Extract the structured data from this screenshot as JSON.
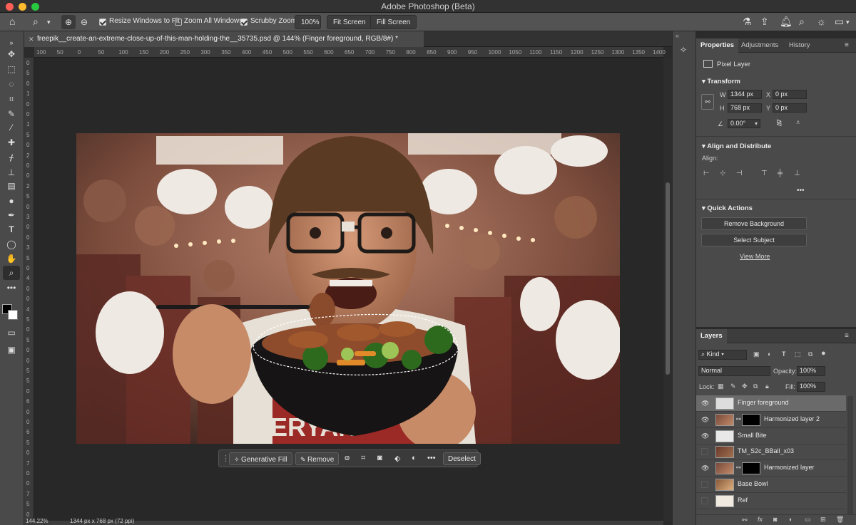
{
  "window": {
    "title": "Adobe Photoshop (Beta)"
  },
  "options_bar": {
    "resize_windows_label": "Resize Windows to Fit",
    "zoom_all_label": "Zoom All Windows",
    "scrubby_zoom_label": "Scrubby Zoom",
    "zoom_value": "100%",
    "fit_screen": "Fit Screen",
    "fill_screen": "Fill Screen"
  },
  "document": {
    "tab_title": "freepik__create-an-extreme-close-up-of-this-man-holding-the__35735.psd @ 144% (Finger foreground, RGB/8#) *"
  },
  "ruler": {
    "h_ticks": [
      "100",
      "50",
      "0",
      "50",
      "100",
      "150",
      "200",
      "250",
      "300",
      "350",
      "400",
      "450",
      "500",
      "550",
      "600",
      "650",
      "700",
      "750",
      "800",
      "850",
      "900",
      "950",
      "1000",
      "1050",
      "1100",
      "1150",
      "1200",
      "1250",
      "1300",
      "1350",
      "1400"
    ],
    "v_ticks": [
      "0",
      "5",
      "0",
      "1",
      "0",
      "0",
      "1",
      "5",
      "0",
      "2",
      "0",
      "0",
      "2",
      "5",
      "0",
      "3",
      "0",
      "0",
      "3",
      "5",
      "0",
      "4",
      "0",
      "0",
      "4",
      "5",
      "0",
      "5",
      "0",
      "0",
      "5",
      "5",
      "0",
      "6",
      "0",
      "0",
      "6",
      "5",
      "0",
      "7",
      "0",
      "0",
      "7",
      "5",
      "0"
    ]
  },
  "context_bar": {
    "generative_fill": "Generative Fill",
    "remove": "Remove",
    "deselect": "Deselect"
  },
  "status": {
    "zoom": "144.22%",
    "doc_size": "1344 px x 768 px (72 ppi)"
  },
  "properties": {
    "tabs": [
      "Properties",
      "Adjustments",
      "History"
    ],
    "layer_type": "Pixel Layer",
    "transform_title": "Transform",
    "w_label": "W",
    "w_value": "1344 px",
    "h_label": "H",
    "h_value": "768 px",
    "x_label": "X",
    "x_value": "0 px",
    "y_label": "Y",
    "y_value": "0 px",
    "angle_value": "0.00°",
    "align_title": "Align and Distribute",
    "align_label": "Align:",
    "quick_actions_title": "Quick Actions",
    "remove_background": "Remove Background",
    "select_subject": "Select Subject",
    "view_more": "View More"
  },
  "layers_panel": {
    "title": "Layers",
    "kind": "Kind",
    "blend_mode": "Normal",
    "opacity_label": "Opacity:",
    "opacity_value": "100%",
    "lock_label": "Lock:",
    "fill_label": "Fill:",
    "fill_value": "100%",
    "layers": [
      {
        "name": "Finger foreground",
        "visible": true,
        "selected": true
      },
      {
        "name": "Harmonized layer 2",
        "visible": true,
        "selected": false
      },
      {
        "name": "Small Bite",
        "visible": true,
        "selected": false
      },
      {
        "name": "TM_S2c_BBall_x03",
        "visible": false,
        "selected": false
      },
      {
        "name": "Harmonized layer",
        "visible": true,
        "selected": false
      },
      {
        "name": "Base Bowl",
        "visible": false,
        "selected": false
      },
      {
        "name": "Ref",
        "visible": false,
        "selected": false
      }
    ]
  },
  "colors": {
    "accent": "#2d8ceb",
    "panel": "#4a4a4a",
    "canvas_bg": "#282828"
  }
}
